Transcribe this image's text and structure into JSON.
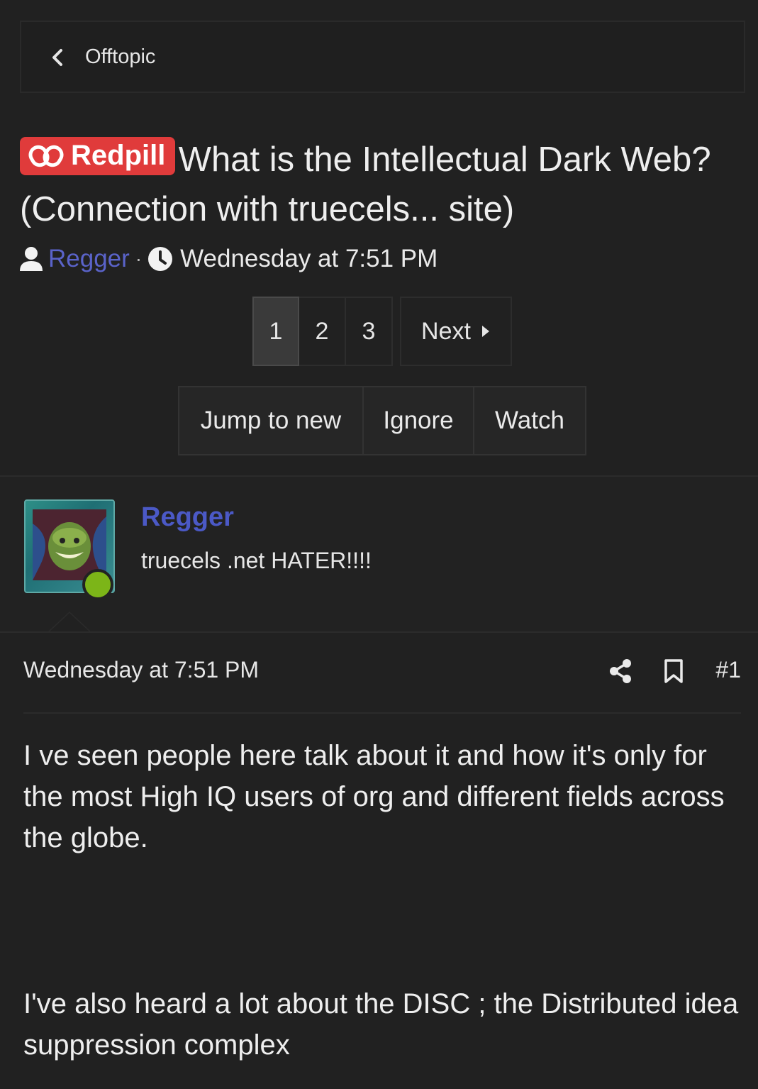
{
  "breadcrumb": {
    "label": "Offtopic"
  },
  "thread": {
    "prefix": "Redpill",
    "title": "What is the Intellectual Dark Web? (Connection with truecels... site)",
    "author": "Regger",
    "separator": "·",
    "date": "Wednesday at 7:51 PM",
    "prefix_color": "#e03b3b"
  },
  "pagination": {
    "pages": [
      "1",
      "2",
      "3"
    ],
    "current": "1",
    "next_label": "Next"
  },
  "actions": {
    "jump": "Jump to new",
    "ignore": "Ignore",
    "watch": "Watch"
  },
  "post": {
    "username": "Regger",
    "user_title": "truecels .net HATER!!!!",
    "date": "Wednesday at 7:51 PM",
    "number": "#1",
    "paragraphs": [
      "I ve seen people here talk about it and how it's only for the most High IQ users of org and different fields across the globe.",
      "I've also heard a lot about the DISC ; the Distributed idea suppression complex"
    ]
  },
  "colors": {
    "link": "#4b59c6",
    "online": "#7cb518",
    "background": "#212121"
  }
}
